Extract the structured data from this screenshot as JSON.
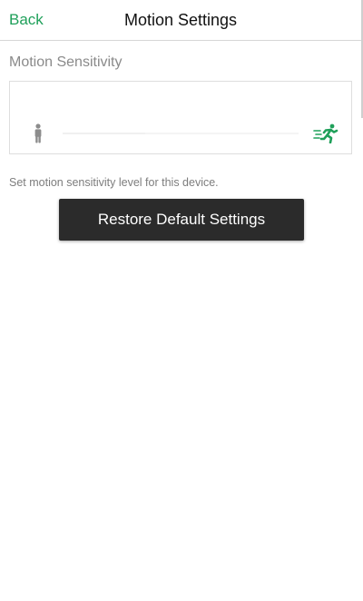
{
  "colors": {
    "accent": "#1fa05a",
    "icon_gray": "#8c8c8c",
    "button_bg": "#2b2b2b"
  },
  "nav": {
    "back_label": "Back",
    "title": "Motion Settings"
  },
  "sensitivity": {
    "section_title": "Motion Sensitivity",
    "low_icon": "walking-person-icon",
    "high_icon": "running-person-icon",
    "level": 0.35,
    "description": "Set motion sensitivity level for this device."
  },
  "actions": {
    "restore_label": "Restore Default Settings"
  }
}
